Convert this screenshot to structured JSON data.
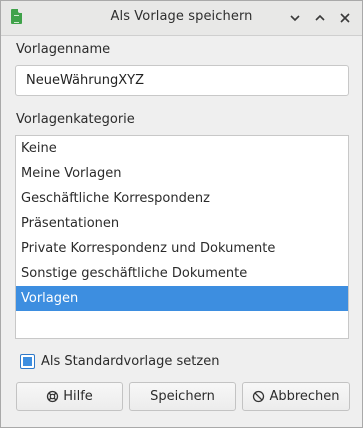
{
  "window": {
    "title": "Als Vorlage speichern",
    "app_icon": "calc-document-icon",
    "controls": [
      "minimize-icon",
      "maximize-icon",
      "close-icon"
    ]
  },
  "template_name": {
    "label": "Vorlagenname",
    "value": "NeueWährungXYZ"
  },
  "category": {
    "label": "Vorlagenkategorie",
    "items": [
      "Keine",
      "Meine Vorlagen",
      "Geschäftliche Korrespondenz",
      "Präsentationen",
      "Private Korrespondenz und Dokumente",
      "Sonstige geschäftliche Dokumente",
      "Vorlagen"
    ],
    "selected": "Vorlagen"
  },
  "default_checkbox": {
    "label": "Als Standardvorlage setzen",
    "checked": true
  },
  "buttons": {
    "help": "Hilfe",
    "save": "Speichern",
    "cancel": "Abbrechen"
  },
  "colors": {
    "selection": "#3d8ee0",
    "window_bg": "#efefef",
    "app_icon": "#3fa24a"
  }
}
